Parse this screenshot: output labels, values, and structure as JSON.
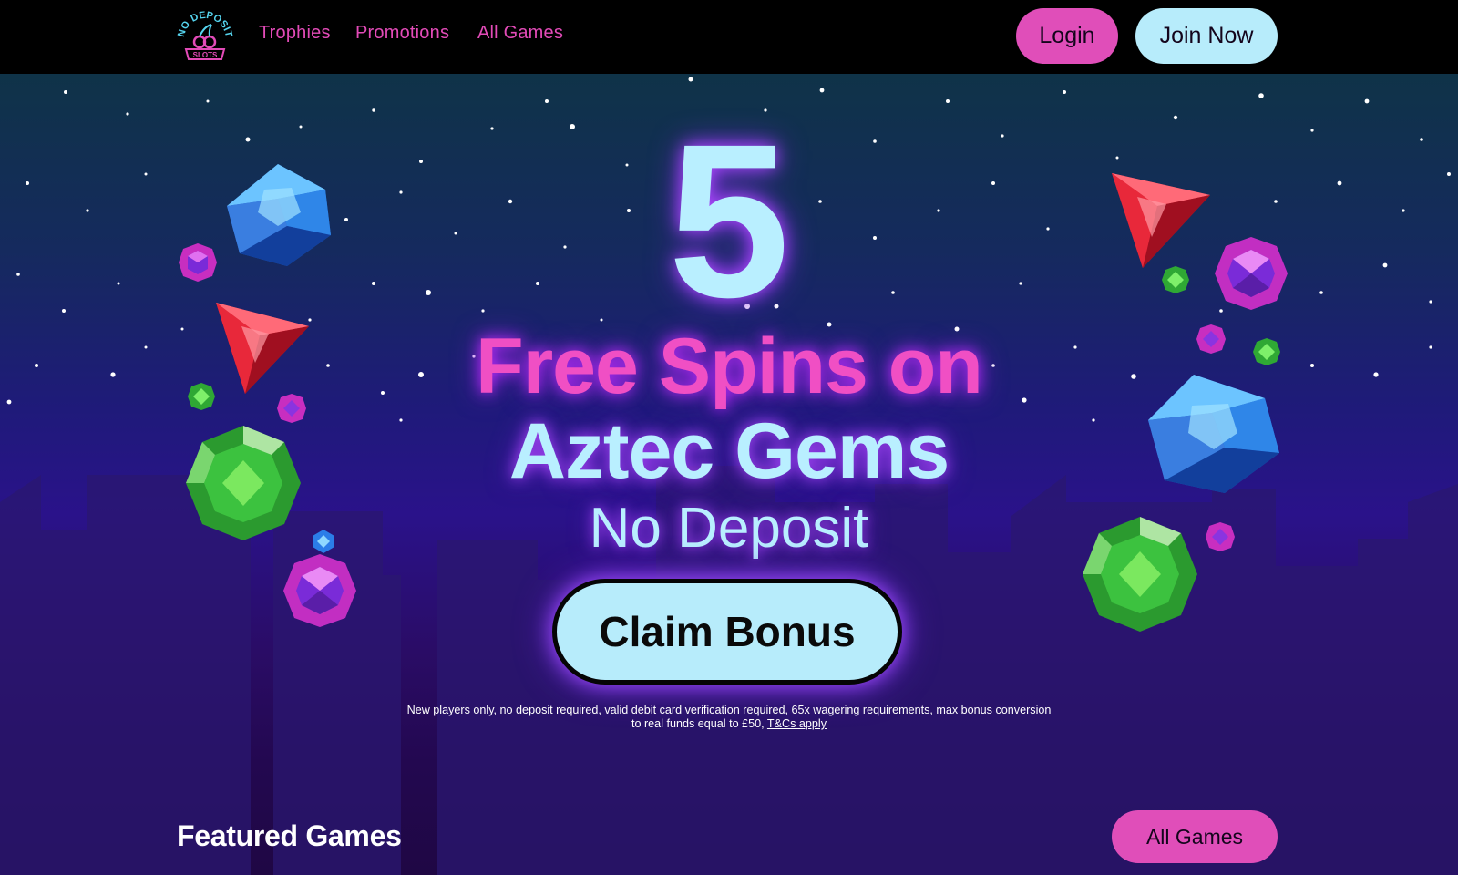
{
  "header": {
    "logo_text_top": "NO DEPOSIT",
    "logo_text_bottom": "SLOTS",
    "nav": [
      {
        "label": "Trophies"
      },
      {
        "label": "Promotions"
      },
      {
        "label": "All Games"
      }
    ],
    "login_label": "Login",
    "join_label": "Join Now"
  },
  "hero": {
    "number": "5",
    "line1": "Free Spins on",
    "line2": "Aztec Gems",
    "line3": "No Deposit",
    "cta_label": "Claim Bonus",
    "terms_text": "New players only, no deposit required, valid debit card verification required, 65x wagering requirements, max bonus conversion to real funds equal to £50,",
    "terms_link": "T&Cs apply"
  },
  "featured": {
    "title": "Featured Games",
    "all_games_label": "All Games"
  },
  "colors": {
    "header_bg": "#000000",
    "pink": "#e04eb9",
    "light_blue": "#b7ecfb",
    "nav_text": "#e34bb8"
  },
  "icons": [
    "logo-cherry-icon",
    "blue-gem-icon",
    "red-gem-icon",
    "green-gem-icon",
    "purple-gem-icon"
  ]
}
